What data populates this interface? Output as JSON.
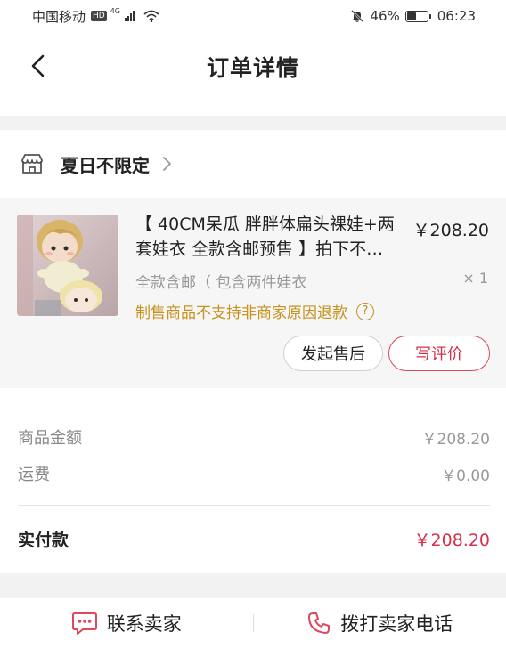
{
  "status_bar": {
    "carrier": "中国移动",
    "hd": "HD",
    "network": "4G",
    "battery": "46%",
    "battery_level": 0.46,
    "time": "06:23"
  },
  "nav": {
    "title": "订单详情"
  },
  "shop": {
    "name": "夏日不限定"
  },
  "product": {
    "title": "【 40CM呆瓜 胖胖体扁头裸娃+两套娃衣 全款含邮预售 】拍下不…",
    "price": "￥208.20",
    "spec": "全款含邮（ 包含两件娃衣",
    "quantity": "× 1",
    "notice": "制售商品不支持非商家原因退款",
    "help_icon": "?",
    "after_sale_label": "发起售后",
    "review_label": "写评价"
  },
  "totals": {
    "goods_label": "商品金额",
    "goods_value": "￥208.20",
    "shipping_label": "运费",
    "shipping_value": "￥0.00",
    "paid_label": "实付款",
    "paid_value": "￥208.20"
  },
  "bottom_bar": {
    "contact_label": "联系卖家",
    "call_label": "拨打卖家电话"
  },
  "colors": {
    "accent_red": "#d6304a",
    "notice_gold": "#c7921e",
    "icon_red": "#e0475d"
  }
}
